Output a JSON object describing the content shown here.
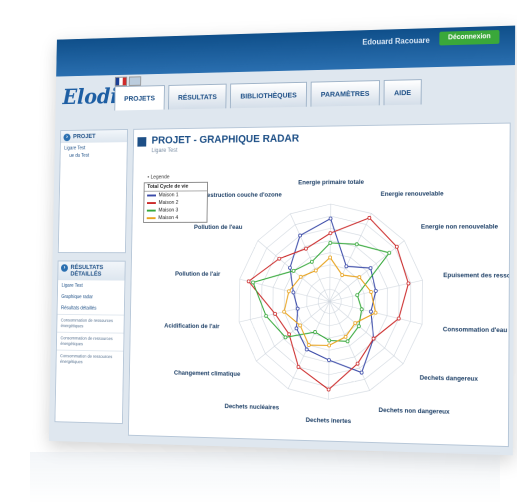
{
  "header": {
    "user_name": "Edouard Racouare",
    "disconnect_label": "Déconnexion",
    "logo_text": "Elodie"
  },
  "nav": {
    "tabs": [
      {
        "label": "PROJETS"
      },
      {
        "label": "RÉSULTATS"
      },
      {
        "label": "BIBLIOTHÈQUES"
      },
      {
        "label": "PARAMÈTRES"
      },
      {
        "label": "AIDE"
      }
    ]
  },
  "sidebar": {
    "project_panel": {
      "title": "PROJET",
      "tree": [
        "Ligare Test",
        "ue du Test"
      ]
    },
    "results_panel": {
      "title": "RÉSULTATS DÉTAILLÉS",
      "items": [
        "Ligare Test",
        "Graphique radar",
        "Résultats détaillés"
      ],
      "entries": [
        "Consommation de ressources énergétiques",
        "Consommation de ressources énergétiques",
        "Consommation de ressources énergétiques"
      ]
    }
  },
  "main": {
    "title": "PROJET - GRAPHIQUE RADAR",
    "subtitle": "Ligare Test"
  },
  "chart_data": {
    "type": "radar",
    "title": "",
    "axes": [
      "Energie primaire totale",
      "Energie renouvelable",
      "Energie non renouvelable",
      "Epuisement des ressources",
      "Consommation d'eau",
      "Dechets dangereux",
      "Dechets non dangereux",
      "Dechets inertes",
      "Dechets nucléaires",
      "Changement climatique",
      "Acidification de l'air",
      "Pollution de l'air",
      "Pollution de l'eau",
      "Destruction couche d'ozone"
    ],
    "range": [
      0,
      100
    ],
    "grid_rings": 8,
    "legend": {
      "caption": "Legende",
      "header": "Total Cycle de vie",
      "placement": "left"
    },
    "series": [
      {
        "name": "Maison 1",
        "color": "#3a4aa8",
        "values": [
          85,
          40,
          55,
          50,
          45,
          60,
          80,
          60,
          55,
          45,
          35,
          40,
          55,
          75
        ]
      },
      {
        "name": "Maison 2",
        "color": "#cc2b2b",
        "values": [
          70,
          95,
          90,
          85,
          75,
          60,
          70,
          90,
          75,
          55,
          60,
          90,
          70,
          60
        ]
      },
      {
        "name": "Maison 3",
        "color": "#35a83a",
        "values": [
          60,
          65,
          80,
          30,
          35,
          40,
          45,
          40,
          35,
          60,
          70,
          85,
          50,
          45
        ]
      },
      {
        "name": "Maison 4",
        "color": "#e8a21c",
        "values": [
          45,
          30,
          40,
          45,
          50,
          35,
          40,
          45,
          50,
          40,
          50,
          45,
          40,
          35
        ]
      }
    ]
  }
}
